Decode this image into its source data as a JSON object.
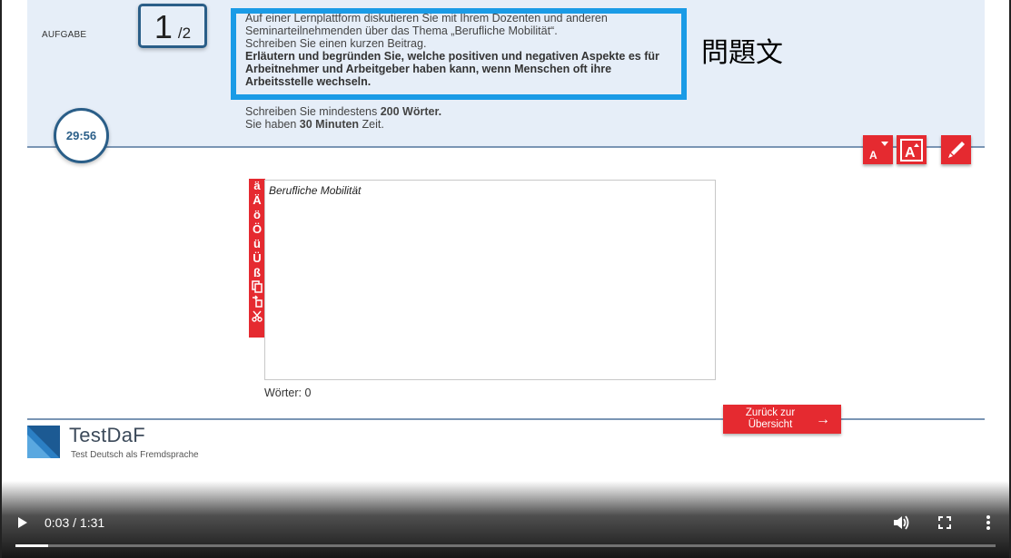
{
  "header": {
    "aufgabe_label": "AUFGABE",
    "task_current": "1",
    "task_total": "/2",
    "task_intro_line1": "Auf einer Lernplattform diskutieren Sie mit Ihrem Dozenten und anderen",
    "task_intro_line2": "Seminarteilnehmenden über das Thema „Berufliche Mobilität“.",
    "task_intro_line3": "Schreiben Sie einen kurzen Beitrag.",
    "task_bold": "Erläutern und begründen Sie, welche positiven und negativen Aspekte es für Arbeitnehmer und Arbeitgeber haben kann, wenn Menschen oft ihre Arbeitsstelle wechseln.",
    "req_words_prefix": "Schreiben Sie mindestens ",
    "req_words_value": "200 Wörter.",
    "req_time_prefix": "Sie haben ",
    "req_time_value": "30 Minuten",
    "req_time_suffix": " Zeit.",
    "annotation": "問題文",
    "timer": "29:56",
    "accent_color": "#e52a30",
    "highlight_color": "#1a9be6"
  },
  "tools": {
    "font_decrease_icon": "font-decrease-icon",
    "font_increase_icon": "font-increase-icon",
    "pen_icon": "pen-icon",
    "font_letter": "A"
  },
  "char_bar": {
    "chars": [
      "ä",
      "Ä",
      "ö",
      "Ö",
      "ü",
      "Ü",
      "ß"
    ],
    "icons": [
      "copy-icon",
      "paste-icon",
      "cut-icon"
    ]
  },
  "editor": {
    "content": "Berufliche Mobilität",
    "word_count_label": "Wörter: 0"
  },
  "footer": {
    "back_button_label": "Zurück zur Übersicht",
    "logo_name": "TestDaF",
    "logo_subtitle": "Test Deutsch als Fremdsprache"
  },
  "video": {
    "time": "0:03 / 1:31",
    "progress": 0.033
  }
}
